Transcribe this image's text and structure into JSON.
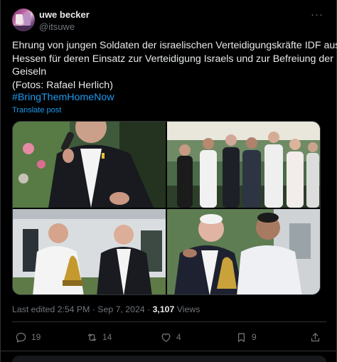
{
  "author": {
    "name": "uwe becker",
    "handle": "@itsuwe",
    "avatar_icon": "avatar-photo"
  },
  "post": {
    "lines": [
      "Ehrung von jungen Soldaten der israelischen Verteidigungskräfte IDF aus",
      "Hessen für deren Einsatz zur Verteidigung Israels und zur Befreiung der",
      "Geiseln",
      "(Fotos: Rafael Herlich)"
    ],
    "hashtag": "#BringThemHomeNow",
    "translate_label": "Translate post"
  },
  "media": {
    "photos": [
      "photo-speaker-microphone",
      "photo-group-garden-party",
      "photo-award-handover",
      "photo-two-men-award"
    ]
  },
  "meta": {
    "edited_label": "Last edited 2:54 PM · Sep 7, 2024 · ",
    "views_count": "3,107",
    "views_label": " Views"
  },
  "actions": {
    "replies": "19",
    "reposts": "14",
    "likes": "4",
    "bookmarks": "9"
  },
  "colors": {
    "background": "#000000",
    "text": "#e7e9ea",
    "muted": "#71767b",
    "link": "#1d9bf0",
    "border": "#2f3336"
  }
}
